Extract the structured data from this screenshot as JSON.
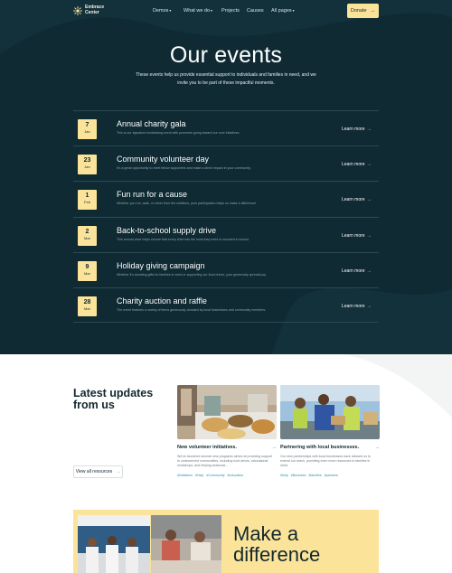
{
  "nav": {
    "logo_text": "Embrace\nCenter",
    "items": [
      {
        "label": "Demos",
        "caret": true
      },
      {
        "label": "What we do",
        "caret": true
      },
      {
        "label": "Projects",
        "caret": false
      },
      {
        "label": "Causes",
        "caret": false
      },
      {
        "label": "All pages",
        "caret": true
      }
    ],
    "donate_label": "Donate",
    "donate_arrow": "→"
  },
  "hero": {
    "title": "Our events",
    "subtitle": "These events help us provide essential support to individuals and families in need, and we invite you to be part of these impactful moments."
  },
  "events": [
    {
      "day": "7",
      "month": "Jan",
      "title": "Annual charity gala",
      "desc": "This is our signature fundraising event with proceeds going toward our core initiatives.",
      "link": "Learn more"
    },
    {
      "day": "23",
      "month": "Jan",
      "title": "Community volunteer day",
      "desc": "It's a great opportunity to meet fellow supporters and make a direct impact in your community.",
      "link": "Learn more"
    },
    {
      "day": "1",
      "month": "Feb",
      "title": "Fun run for a cause",
      "desc": "Whether you run, walk, or cheer from the sidelines, your participation helps us make a difference!",
      "link": "Learn more"
    },
    {
      "day": "2",
      "month": "Mar",
      "title": "Back-to-school supply drive",
      "desc": "This annual drive helps ensure that every child has the tools they need to succeed in school.",
      "link": "Learn more"
    },
    {
      "day": "9",
      "month": "Mar",
      "title": "Holiday giving campaign",
      "desc": "Whether it's donating gifts for families in need or supporting our food drives, your generosity spreads joy.",
      "link": "Learn more"
    },
    {
      "day": "28",
      "month": "Mar",
      "title": "Charity auction and raffle",
      "desc": "The event features a variety of items generously donated by local businesses and community members.",
      "link": "Learn more"
    }
  ],
  "updates": {
    "title": "Latest updates\nfrom us",
    "view_all": "View all resources",
    "cards": [
      {
        "title": "New volunteer initiatives.",
        "desc": "We've launched several new programs aimed at providing support to underserved communities, including food drives, educational workshops, and helping seasonal...",
        "tags": [
          "#Initiatives",
          "#Help",
          "#Community",
          "#education"
        ]
      },
      {
        "title": "Partnering with local businesses.",
        "desc": "Our new partnerships with local businesses have allowed us to extend our reach, providing even more resources to families in need.",
        "tags": [
          "#help",
          "#Business",
          "#families",
          "#partners"
        ]
      }
    ]
  },
  "banner": {
    "text": "Make a\ndifference"
  },
  "colors": {
    "dark_bg": "#0f2a33",
    "accent_yellow": "#fbe49a",
    "link_teal": "#2a8fa8"
  }
}
